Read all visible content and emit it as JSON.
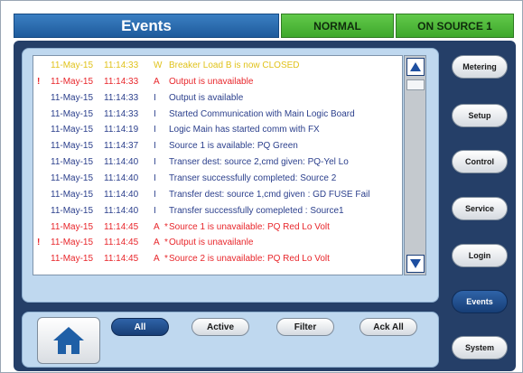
{
  "header": {
    "title": "Events",
    "status": "NORMAL",
    "source": "ON SOURCE 1"
  },
  "colors": {
    "warning": "#e0c21a",
    "alarm": "#e8262b",
    "info": "#2b3f8c",
    "status_green": "#4bb83a",
    "title_blue": "#2a6cb0"
  },
  "events": [
    {
      "flag": "",
      "date": "11-May-15",
      "time": "11:14:33",
      "type": "W",
      "star": "",
      "message": "Breaker Load B is now CLOSED",
      "level": "warning"
    },
    {
      "flag": "!",
      "date": "11-May-15",
      "time": "11:14:33",
      "type": "A",
      "star": "",
      "message": "Output is unavailable",
      "level": "alarm"
    },
    {
      "flag": "",
      "date": "11-May-15",
      "time": "11:14:33",
      "type": "I",
      "star": "",
      "message": "Output is available",
      "level": "info"
    },
    {
      "flag": "",
      "date": "11-May-15",
      "time": "11:14:33",
      "type": "I",
      "star": "",
      "message": "Started Communication with Main Logic Board",
      "level": "info"
    },
    {
      "flag": "",
      "date": "11-May-15",
      "time": "11:14:19",
      "type": "I",
      "star": "",
      "message": "Logic Main has started comm with FX",
      "level": "info"
    },
    {
      "flag": "",
      "date": "11-May-15",
      "time": "11:14:37",
      "type": "I",
      "star": "",
      "message": "Source 1 is available: PQ Green",
      "level": "info"
    },
    {
      "flag": "",
      "date": "11-May-15",
      "time": "11:14:40",
      "type": "I",
      "star": "",
      "message": "Transer dest: source 2,cmd given: PQ-Yel Lo",
      "level": "info"
    },
    {
      "flag": "",
      "date": "11-May-15",
      "time": "11:14:40",
      "type": "I",
      "star": "",
      "message": "Transer successfully completed: Source 2",
      "level": "info"
    },
    {
      "flag": "",
      "date": "11-May-15",
      "time": "11:14:40",
      "type": "I",
      "star": "",
      "message": "Transfer dest: source 1,cmd given : GD FUSE Fail",
      "level": "info"
    },
    {
      "flag": "",
      "date": "11-May-15",
      "time": "11:14:40",
      "type": "I",
      "star": "",
      "message": "Transfer successfully comepleted : Source1",
      "level": "info"
    },
    {
      "flag": "",
      "date": "11-May-15",
      "time": "11:14:45",
      "type": "A",
      "star": "*",
      "message": "Source 1 is unavailable: PQ Red Lo Volt",
      "level": "alarm"
    },
    {
      "flag": "!",
      "date": "11-May-15",
      "time": "11:14:45",
      "type": "A",
      "star": "*",
      "message": "Output is unavailanle",
      "level": "alarm"
    },
    {
      "flag": "",
      "date": "11-May-15",
      "time": "11:14:45",
      "type": "A",
      "star": "*",
      "message": "Source 2 is unavailable: PQ Red Lo Volt",
      "level": "alarm"
    }
  ],
  "filter_buttons": {
    "all": "All",
    "active": "Active",
    "filter": "Filter",
    "ack_all": "Ack All"
  },
  "nav": {
    "metering": "Metering",
    "setup": "Setup",
    "control": "Control",
    "service": "Service",
    "login": "Login",
    "events": "Events",
    "system": "System"
  },
  "icons": {
    "home": "home-icon",
    "scroll_up": "arrow-up-icon",
    "scroll_down": "arrow-down-icon"
  }
}
